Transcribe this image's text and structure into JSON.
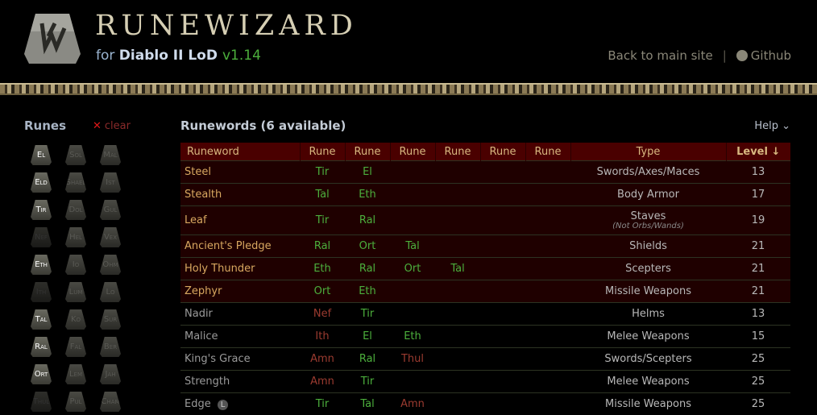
{
  "header": {
    "title": "RUNEWIZARD",
    "for": "for",
    "game": "Diablo II LoD",
    "version": "v1.14",
    "back": "Back to main site",
    "sep": "|",
    "github": "Github"
  },
  "sidebar": {
    "title": "Runes",
    "clear": "clear",
    "runes": [
      {
        "n": "El",
        "s": "on"
      },
      {
        "n": "Sol",
        "s": ""
      },
      {
        "n": "Mal",
        "s": ""
      },
      {
        "n": "Eld",
        "s": "on"
      },
      {
        "n": "Shael",
        "s": ""
      },
      {
        "n": "Ist",
        "s": ""
      },
      {
        "n": "Tir",
        "s": "on"
      },
      {
        "n": "Dol",
        "s": ""
      },
      {
        "n": "Gul",
        "s": ""
      },
      {
        "n": "Nef",
        "s": "dim"
      },
      {
        "n": "Hel",
        "s": ""
      },
      {
        "n": "Vex",
        "s": ""
      },
      {
        "n": "Eth",
        "s": "on"
      },
      {
        "n": "Io",
        "s": ""
      },
      {
        "n": "Ohm",
        "s": ""
      },
      {
        "n": "Ith",
        "s": "dim"
      },
      {
        "n": "Lum",
        "s": ""
      },
      {
        "n": "Lo",
        "s": ""
      },
      {
        "n": "Tal",
        "s": "on"
      },
      {
        "n": "Ko",
        "s": ""
      },
      {
        "n": "Sur",
        "s": ""
      },
      {
        "n": "Ral",
        "s": "on"
      },
      {
        "n": "Fal",
        "s": ""
      },
      {
        "n": "Ber",
        "s": ""
      },
      {
        "n": "Ort",
        "s": "on"
      },
      {
        "n": "Lem",
        "s": ""
      },
      {
        "n": "Jah",
        "s": ""
      },
      {
        "n": "Thul",
        "s": "dim"
      },
      {
        "n": "Pul",
        "s": ""
      },
      {
        "n": "Cham",
        "s": ""
      }
    ]
  },
  "main": {
    "title": "Runewords (6 available)",
    "help": "Help",
    "columns": [
      "Runeword",
      "Rune",
      "Rune",
      "Rune",
      "Rune",
      "Rune",
      "Rune",
      "Type",
      "Level ↓"
    ],
    "rows": [
      {
        "name": "Steel",
        "runes": [
          [
            "Tir",
            "g"
          ],
          [
            "El",
            "g"
          ]
        ],
        "type": "Swords/Axes/Maces",
        "level": "13",
        "avail": true
      },
      {
        "name": "Stealth",
        "runes": [
          [
            "Tal",
            "g"
          ],
          [
            "Eth",
            "g"
          ]
        ],
        "type": "Body Armor",
        "level": "17",
        "avail": true
      },
      {
        "name": "Leaf",
        "runes": [
          [
            "Tir",
            "g"
          ],
          [
            "Ral",
            "g"
          ]
        ],
        "type": "Staves",
        "note": "(Not Orbs/Wands)",
        "level": "19",
        "avail": true
      },
      {
        "name": "Ancient's Pledge",
        "runes": [
          [
            "Ral",
            "g"
          ],
          [
            "Ort",
            "g"
          ],
          [
            "Tal",
            "g"
          ]
        ],
        "type": "Shields",
        "level": "21",
        "avail": true
      },
      {
        "name": "Holy Thunder",
        "runes": [
          [
            "Eth",
            "g"
          ],
          [
            "Ral",
            "g"
          ],
          [
            "Ort",
            "g"
          ],
          [
            "Tal",
            "g"
          ]
        ],
        "type": "Scepters",
        "level": "21",
        "avail": true
      },
      {
        "name": "Zephyr",
        "runes": [
          [
            "Ort",
            "g"
          ],
          [
            "Eth",
            "g"
          ]
        ],
        "type": "Missile Weapons",
        "level": "21",
        "avail": true
      },
      {
        "name": "Nadir",
        "runes": [
          [
            "Nef",
            "r"
          ],
          [
            "Tir",
            "g"
          ]
        ],
        "type": "Helms",
        "level": "13",
        "avail": false
      },
      {
        "name": "Malice",
        "runes": [
          [
            "Ith",
            "r"
          ],
          [
            "El",
            "g"
          ],
          [
            "Eth",
            "g"
          ]
        ],
        "type": "Melee Weapons",
        "level": "15",
        "avail": false
      },
      {
        "name": "King's Grace",
        "runes": [
          [
            "Amn",
            "r"
          ],
          [
            "Ral",
            "g"
          ],
          [
            "Thul",
            "r"
          ]
        ],
        "type": "Swords/Scepters",
        "level": "25",
        "avail": false
      },
      {
        "name": "Strength",
        "runes": [
          [
            "Amn",
            "r"
          ],
          [
            "Tir",
            "g"
          ]
        ],
        "type": "Melee Weapons",
        "level": "25",
        "avail": false
      },
      {
        "name": "Edge",
        "badge": "L",
        "runes": [
          [
            "Tir",
            "g"
          ],
          [
            "Tal",
            "g"
          ],
          [
            "Amn",
            "r"
          ]
        ],
        "type": "Missile Weapons",
        "level": "25",
        "avail": false
      }
    ]
  },
  "colors": {
    "available_rune": "#4caf3c",
    "missing_rune": "#9b3b30",
    "header_bg": "#4a0000",
    "row_available_bg": "#1f0000"
  }
}
